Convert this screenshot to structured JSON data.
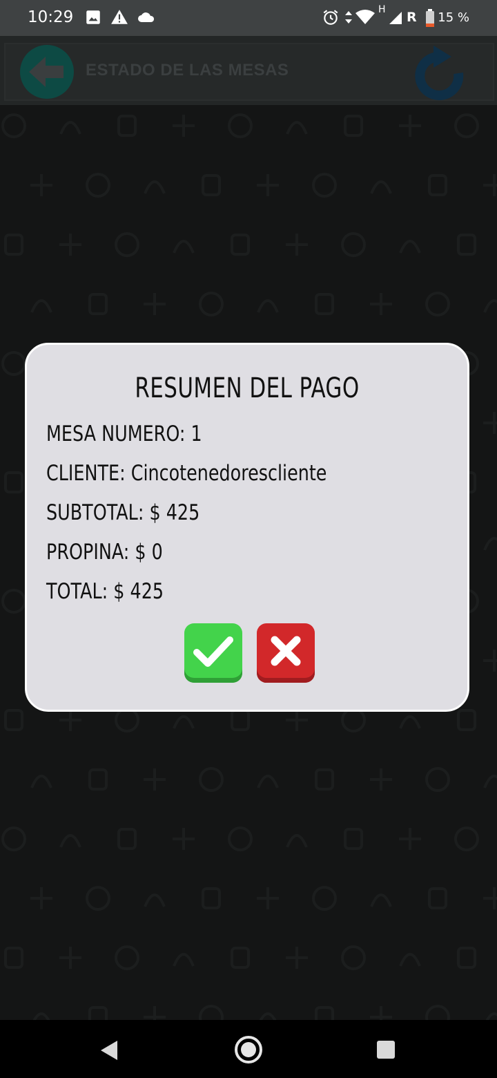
{
  "status_bar": {
    "time": "10:29",
    "network_label": "R",
    "network_type": "H",
    "battery_percent": "15 %",
    "icons": [
      "image-icon",
      "warning-icon",
      "cloud-icon",
      "alarm-icon",
      "data-arrows-icon",
      "wifi-icon",
      "signal-icon",
      "battery-icon"
    ]
  },
  "app_bar": {
    "title": "ESTADO DE LAS MESAS",
    "back_icon": "arrow-left-icon",
    "refresh_icon": "refresh-icon"
  },
  "dialog": {
    "title": "RESUMEN DEL PAGO",
    "table_number": "MESA NUMERO: 1",
    "client": "CLIENTE: Cincotenedorescliente",
    "subtotal": "SUBTOTAL: $ 425",
    "tip": "PROPINA: $ 0",
    "total": "TOTAL: $ 425",
    "confirm_icon": "checkmark-icon",
    "cancel_icon": "close-icon"
  },
  "nav_bar": {
    "icons": [
      "back-triangle-icon",
      "home-circle-icon",
      "recents-square-icon"
    ]
  },
  "colors": {
    "confirm": "#43d34b",
    "cancel": "#d2282a",
    "dialog_bg": "#dfdee3",
    "back_button": "#0d4a44",
    "refresh_button": "#0f2f46"
  }
}
